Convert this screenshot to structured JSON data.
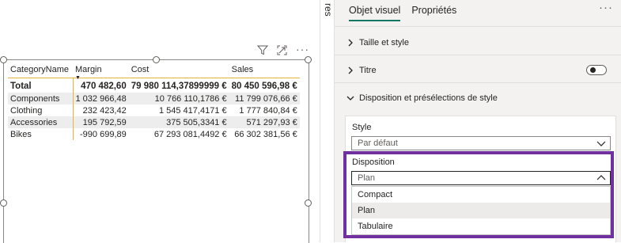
{
  "visual": {
    "columns": [
      "CategoryName",
      "Margin",
      "Cost",
      "Sales"
    ],
    "total_row": {
      "label": "Total",
      "margin": "470 482,60",
      "cost": "79 980 114,37899999 €",
      "sales": "80 450 596,98 €"
    },
    "rows": [
      {
        "label": "Components",
        "margin": "1 032 966,48",
        "cost": "10 766 110,1786 €",
        "sales": "11 799 076,66 €"
      },
      {
        "label": "Clothing",
        "margin": "232 423,42",
        "cost": "1 545 417,4171 €",
        "sales": "1 777 840,84 €"
      },
      {
        "label": "Accessories",
        "margin": "195 792,59",
        "cost": "375 505,3341 €",
        "sales": "571 297,93 €"
      },
      {
        "label": "Bikes",
        "margin": "-990 699,89",
        "cost": "67 293 081,4492 €",
        "sales": "66 302 381,56 €"
      }
    ],
    "header_icons": [
      "filter-icon",
      "focus-mode-icon",
      "more-options-icon"
    ],
    "more_label": "···"
  },
  "strip": {
    "label": "res"
  },
  "pane": {
    "tabs": [
      {
        "label": "Objet visuel",
        "active": true
      },
      {
        "label": "Propriétés",
        "active": false
      }
    ],
    "more_label": "···",
    "sections": [
      {
        "label": "Taille et style",
        "expanded": false
      },
      {
        "label": "Titre",
        "expanded": false,
        "toggle": "off"
      },
      {
        "label": "Disposition et présélections de style",
        "expanded": true
      }
    ],
    "style_label": "Style",
    "style_value": "Par défaut",
    "layout_label": "Disposition",
    "layout_value": "Plan",
    "layout_options": [
      "Compact",
      "Plan",
      "Tabulaire"
    ],
    "selected_option": "Plan",
    "peek_text": "",
    "highlight_color": "#7030a0",
    "accent_color": "#117865",
    "gridline_color": "#e8b33a"
  }
}
